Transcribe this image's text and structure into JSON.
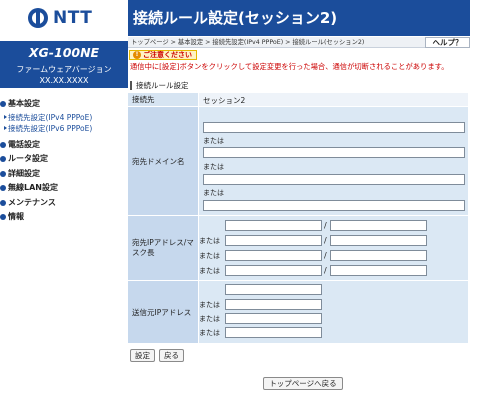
{
  "brand": {
    "logo_text": "NTT",
    "accent": "#1b4d9b"
  },
  "device": {
    "model": "XG-100NE",
    "firmware_label": "ファームウェアバージョン",
    "firmware_version": "XX.XX.XXXX"
  },
  "nav": {
    "basic": "基本設定",
    "basic_sub1": "接続先設定(IPv4 PPPoE)",
    "basic_sub2": "接続先設定(IPv6 PPPoE)",
    "phone": "電話設定",
    "router": "ルータ設定",
    "detail": "詳細設定",
    "wlan": "無線LAN設定",
    "maintenance": "メンテナンス",
    "info": "情報"
  },
  "header": {
    "title": "接続ルール設定(セッション2)"
  },
  "breadcrumb": {
    "text": "トップページ > 基本設定 > 接続先設定(IPv4 PPPoE) > 接続ルール(セッション2)",
    "help": "ヘルプ？"
  },
  "notice": {
    "badge": "ご注意ください",
    "text": "通信中に[設定]ボタンをクリックして設定変更を行った場合、通信が切断されることがあります。"
  },
  "form": {
    "section_title": "接続ルール設定",
    "connection_label": "接続先",
    "connection_value": "セッション2",
    "domain_label": "宛先ドメイン名",
    "or_label": "または",
    "dst_ip_label": "宛先IPアドレス/マスク長",
    "slash": "/",
    "src_ip_label": "送信元IPアドレス"
  },
  "buttons": {
    "set": "設定",
    "back": "戻る",
    "top": "トップページへ戻る"
  }
}
